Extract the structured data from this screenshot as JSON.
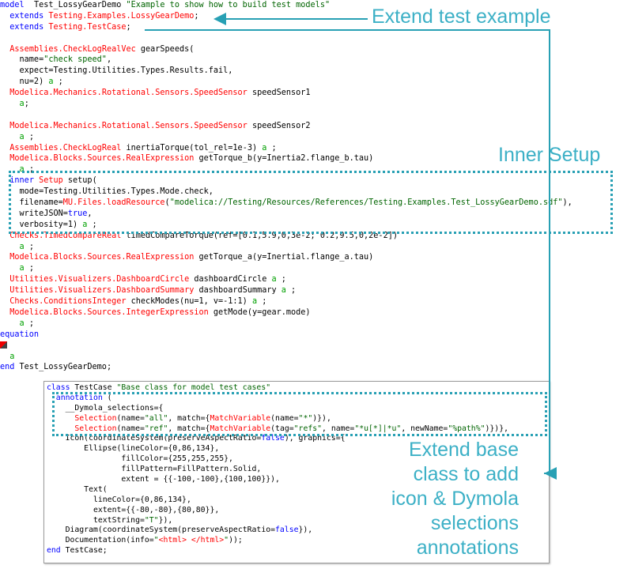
{
  "main_code": [
    [
      [
        "kw",
        "model"
      ],
      [
        "",
        "  Test_LossyGearDemo "
      ],
      [
        "str",
        "\"Example to show how to build test models\""
      ]
    ],
    [
      [
        "",
        "  "
      ],
      [
        "kw",
        "extends"
      ],
      [
        "",
        " "
      ],
      [
        "typ",
        "Testing.Examples.LossyGearDemo"
      ],
      [
        "",
        ";"
      ]
    ],
    [
      [
        "",
        "  "
      ],
      [
        "kw",
        "extends"
      ],
      [
        "",
        " "
      ],
      [
        "typ",
        "Testing.TestCase"
      ],
      [
        "",
        ";"
      ]
    ],
    [],
    [
      [
        "",
        "  "
      ],
      [
        "typ",
        "Assemblies.CheckLogRealVec"
      ],
      [
        "",
        " gearSpeeds("
      ]
    ],
    [
      [
        "",
        "    name="
      ],
      [
        "str",
        "\"check speed\""
      ],
      [
        "",
        ","
      ]
    ],
    [
      [
        "",
        "    expect=Testing.Utilities.Types.Results.fail,"
      ]
    ],
    [
      [
        "",
        "    nu=2) "
      ],
      [
        "ann",
        "a"
      ],
      [
        "",
        " ;"
      ]
    ],
    [
      [
        "",
        "  "
      ],
      [
        "typ",
        "Modelica.Mechanics.Rotational.Sensors.SpeedSensor"
      ],
      [
        "",
        " speedSensor1"
      ]
    ],
    [
      [
        "",
        "    "
      ],
      [
        "ann",
        "a"
      ],
      [
        "",
        ";"
      ]
    ],
    [],
    [
      [
        "",
        "  "
      ],
      [
        "typ",
        "Modelica.Mechanics.Rotational.Sensors.SpeedSensor"
      ],
      [
        "",
        " speedSensor2"
      ]
    ],
    [
      [
        "",
        "    "
      ],
      [
        "ann",
        "a"
      ],
      [
        "",
        " ;"
      ]
    ],
    [
      [
        "",
        "  "
      ],
      [
        "typ",
        "Assemblies.CheckLogReal"
      ],
      [
        "",
        " inertiaTorque(tol_rel=1e-3) "
      ],
      [
        "ann",
        "a"
      ],
      [
        "",
        " ;"
      ]
    ],
    [
      [
        "",
        "  "
      ],
      [
        "typ",
        "Modelica.Blocks.Sources.RealExpression"
      ],
      [
        "",
        " getTorque_b(y=Inertia2.flange_b.tau)"
      ]
    ],
    [
      [
        "",
        "    "
      ],
      [
        "ann",
        "a"
      ],
      [
        "",
        " ;"
      ]
    ],
    [
      [
        "",
        "  "
      ],
      [
        "kw",
        "inner"
      ],
      [
        "",
        " "
      ],
      [
        "typ",
        "Setup"
      ],
      [
        "",
        " setup("
      ]
    ],
    [
      [
        "",
        "    mode=Testing.Utilities.Types.Mode.check,"
      ]
    ],
    [
      [
        "",
        "    filename="
      ],
      [
        "typ",
        "MU.Files.loadResource"
      ],
      [
        "",
        "("
      ],
      [
        "str",
        "\"modelica://Testing/Resources/References/Testing.Examples.Test_LossyGearDemo.sdf\""
      ],
      [
        "",
        "),"
      ]
    ],
    [
      [
        "",
        "    writeJSON="
      ],
      [
        "kw",
        "true"
      ],
      [
        "",
        ","
      ]
    ],
    [
      [
        "",
        "    verbosity=1) "
      ],
      [
        "ann",
        "a"
      ],
      [
        "",
        " ;"
      ]
    ],
    [
      [
        "",
        "  "
      ],
      [
        "typ",
        "Checks.TimedCompareReal"
      ],
      [
        "",
        " timedCompareTorque(ref=[0.1,5.9,0,3e-2; 0.2,9.5,0,2e-2])"
      ]
    ],
    [
      [
        "",
        "    "
      ],
      [
        "ann",
        "a"
      ],
      [
        "",
        " ;"
      ]
    ],
    [
      [
        "",
        "  "
      ],
      [
        "typ",
        "Modelica.Blocks.Sources.RealExpression"
      ],
      [
        "",
        " getTorque_a(y=Inertial.flange_a.tau)"
      ]
    ],
    [
      [
        "",
        "    "
      ],
      [
        "ann",
        "a"
      ],
      [
        "",
        " ;"
      ]
    ],
    [
      [
        "",
        "  "
      ],
      [
        "typ",
        "Utilities.Visualizers.DashboardCircle"
      ],
      [
        "",
        " dashboardCircle "
      ],
      [
        "ann",
        "a"
      ],
      [
        "",
        " ;"
      ]
    ],
    [
      [
        "",
        "  "
      ],
      [
        "typ",
        "Utilities.Visualizers.DashboardSummary"
      ],
      [
        "",
        " dashboardSummary "
      ],
      [
        "ann",
        "a"
      ],
      [
        "",
        " ;"
      ]
    ],
    [
      [
        "",
        "  "
      ],
      [
        "typ",
        "Checks.ConditionsInteger"
      ],
      [
        "",
        " checkModes(nu=1, v=-1:1) "
      ],
      [
        "ann",
        "a"
      ],
      [
        "",
        " ;"
      ]
    ],
    [
      [
        "",
        "  "
      ],
      [
        "typ",
        "Modelica.Blocks.Sources.IntegerExpression"
      ],
      [
        "",
        " getMode(y=gear.mode)"
      ]
    ],
    [
      [
        "",
        "    "
      ],
      [
        "ann",
        "a"
      ],
      [
        "",
        " ;"
      ]
    ],
    [
      [
        "kw",
        "equation"
      ]
    ],
    [
      [
        "icon",
        ""
      ]
    ],
    [
      [
        "",
        "  "
      ],
      [
        "ann",
        "a"
      ]
    ],
    [
      [
        "kw",
        "end"
      ],
      [
        "",
        " Test_LossyGearDemo;"
      ]
    ]
  ],
  "panel_code": [
    [
      [
        "kw",
        "class"
      ],
      [
        "",
        " TestCase "
      ],
      [
        "str",
        "\"Base class for model test cases\""
      ]
    ],
    [
      [
        "",
        "  "
      ],
      [
        "kw",
        "annotation"
      ],
      [
        "",
        " ("
      ]
    ],
    [
      [
        "",
        "    __Dymola_selections={"
      ]
    ],
    [
      [
        "",
        "      "
      ],
      [
        "typ",
        "Selection"
      ],
      [
        "",
        "(name="
      ],
      [
        "str",
        "\"all\""
      ],
      [
        "",
        ", match={"
      ],
      [
        "typ",
        "MatchVariable"
      ],
      [
        "",
        "(name="
      ],
      [
        "str",
        "\"*\""
      ],
      [
        "",
        ")}),"
      ]
    ],
    [
      [
        "",
        "      "
      ],
      [
        "typ",
        "Selection"
      ],
      [
        "",
        "(name="
      ],
      [
        "str",
        "\"ref\""
      ],
      [
        "",
        ", match={"
      ],
      [
        "typ",
        "MatchVariable"
      ],
      [
        "",
        "(tag="
      ],
      [
        "str",
        "\"refs\""
      ],
      [
        "",
        ", name="
      ],
      [
        "str",
        "\"*u[*]|*u\""
      ],
      [
        "",
        ", newName="
      ],
      [
        "str",
        "\"%path%\""
      ],
      [
        "",
        ")})},"
      ]
    ],
    [
      [
        "",
        "    Icon(coordinateSystem(preserveAspectRatio="
      ],
      [
        "kw",
        "false"
      ],
      [
        "",
        "), graphics={"
      ]
    ],
    [
      [
        "",
        "        Ellipse(lineColor={0,86,134},"
      ]
    ],
    [
      [
        "",
        "                fillColor={255,255,255},"
      ]
    ],
    [
      [
        "",
        "                fillPattern=FillPattern.Solid,"
      ]
    ],
    [
      [
        "",
        "                extent = {{-100,-100},{100,100}}),"
      ]
    ],
    [
      [
        "",
        "        Text("
      ]
    ],
    [
      [
        "",
        "          lineColor={0,86,134},"
      ]
    ],
    [
      [
        "",
        "          extent={{-80,-80},{80,80}},"
      ]
    ],
    [
      [
        "",
        "          textString="
      ],
      [
        "str",
        "\"T\""
      ],
      [
        "",
        "}),"
      ]
    ],
    [
      [
        "",
        "    Diagram(coordinateSystem(preserveAspectRatio="
      ],
      [
        "kw",
        "false"
      ],
      [
        "",
        "}),"
      ]
    ],
    [
      [
        "",
        "    Documentation(info="
      ],
      [
        "str",
        "\""
      ],
      [
        "typ",
        "<html> </html>"
      ],
      [
        "str",
        "\""
      ],
      [
        "",
        "));"
      ]
    ],
    [
      [
        "kw",
        "end"
      ],
      [
        "",
        " TestCase;"
      ]
    ]
  ],
  "callouts": {
    "extend_test": "Extend test example",
    "inner_setup": "Inner Setup",
    "extend_base": [
      "Extend base",
      "class to add",
      "icon & Dymola",
      "selections",
      "annotations"
    ]
  },
  "colors": {
    "keyword": "#0000ff",
    "type": "#ff0000",
    "string": "#006400",
    "annotation": "#00a000",
    "callout": "#3cb0c6",
    "arrow": "#28a0b4"
  }
}
